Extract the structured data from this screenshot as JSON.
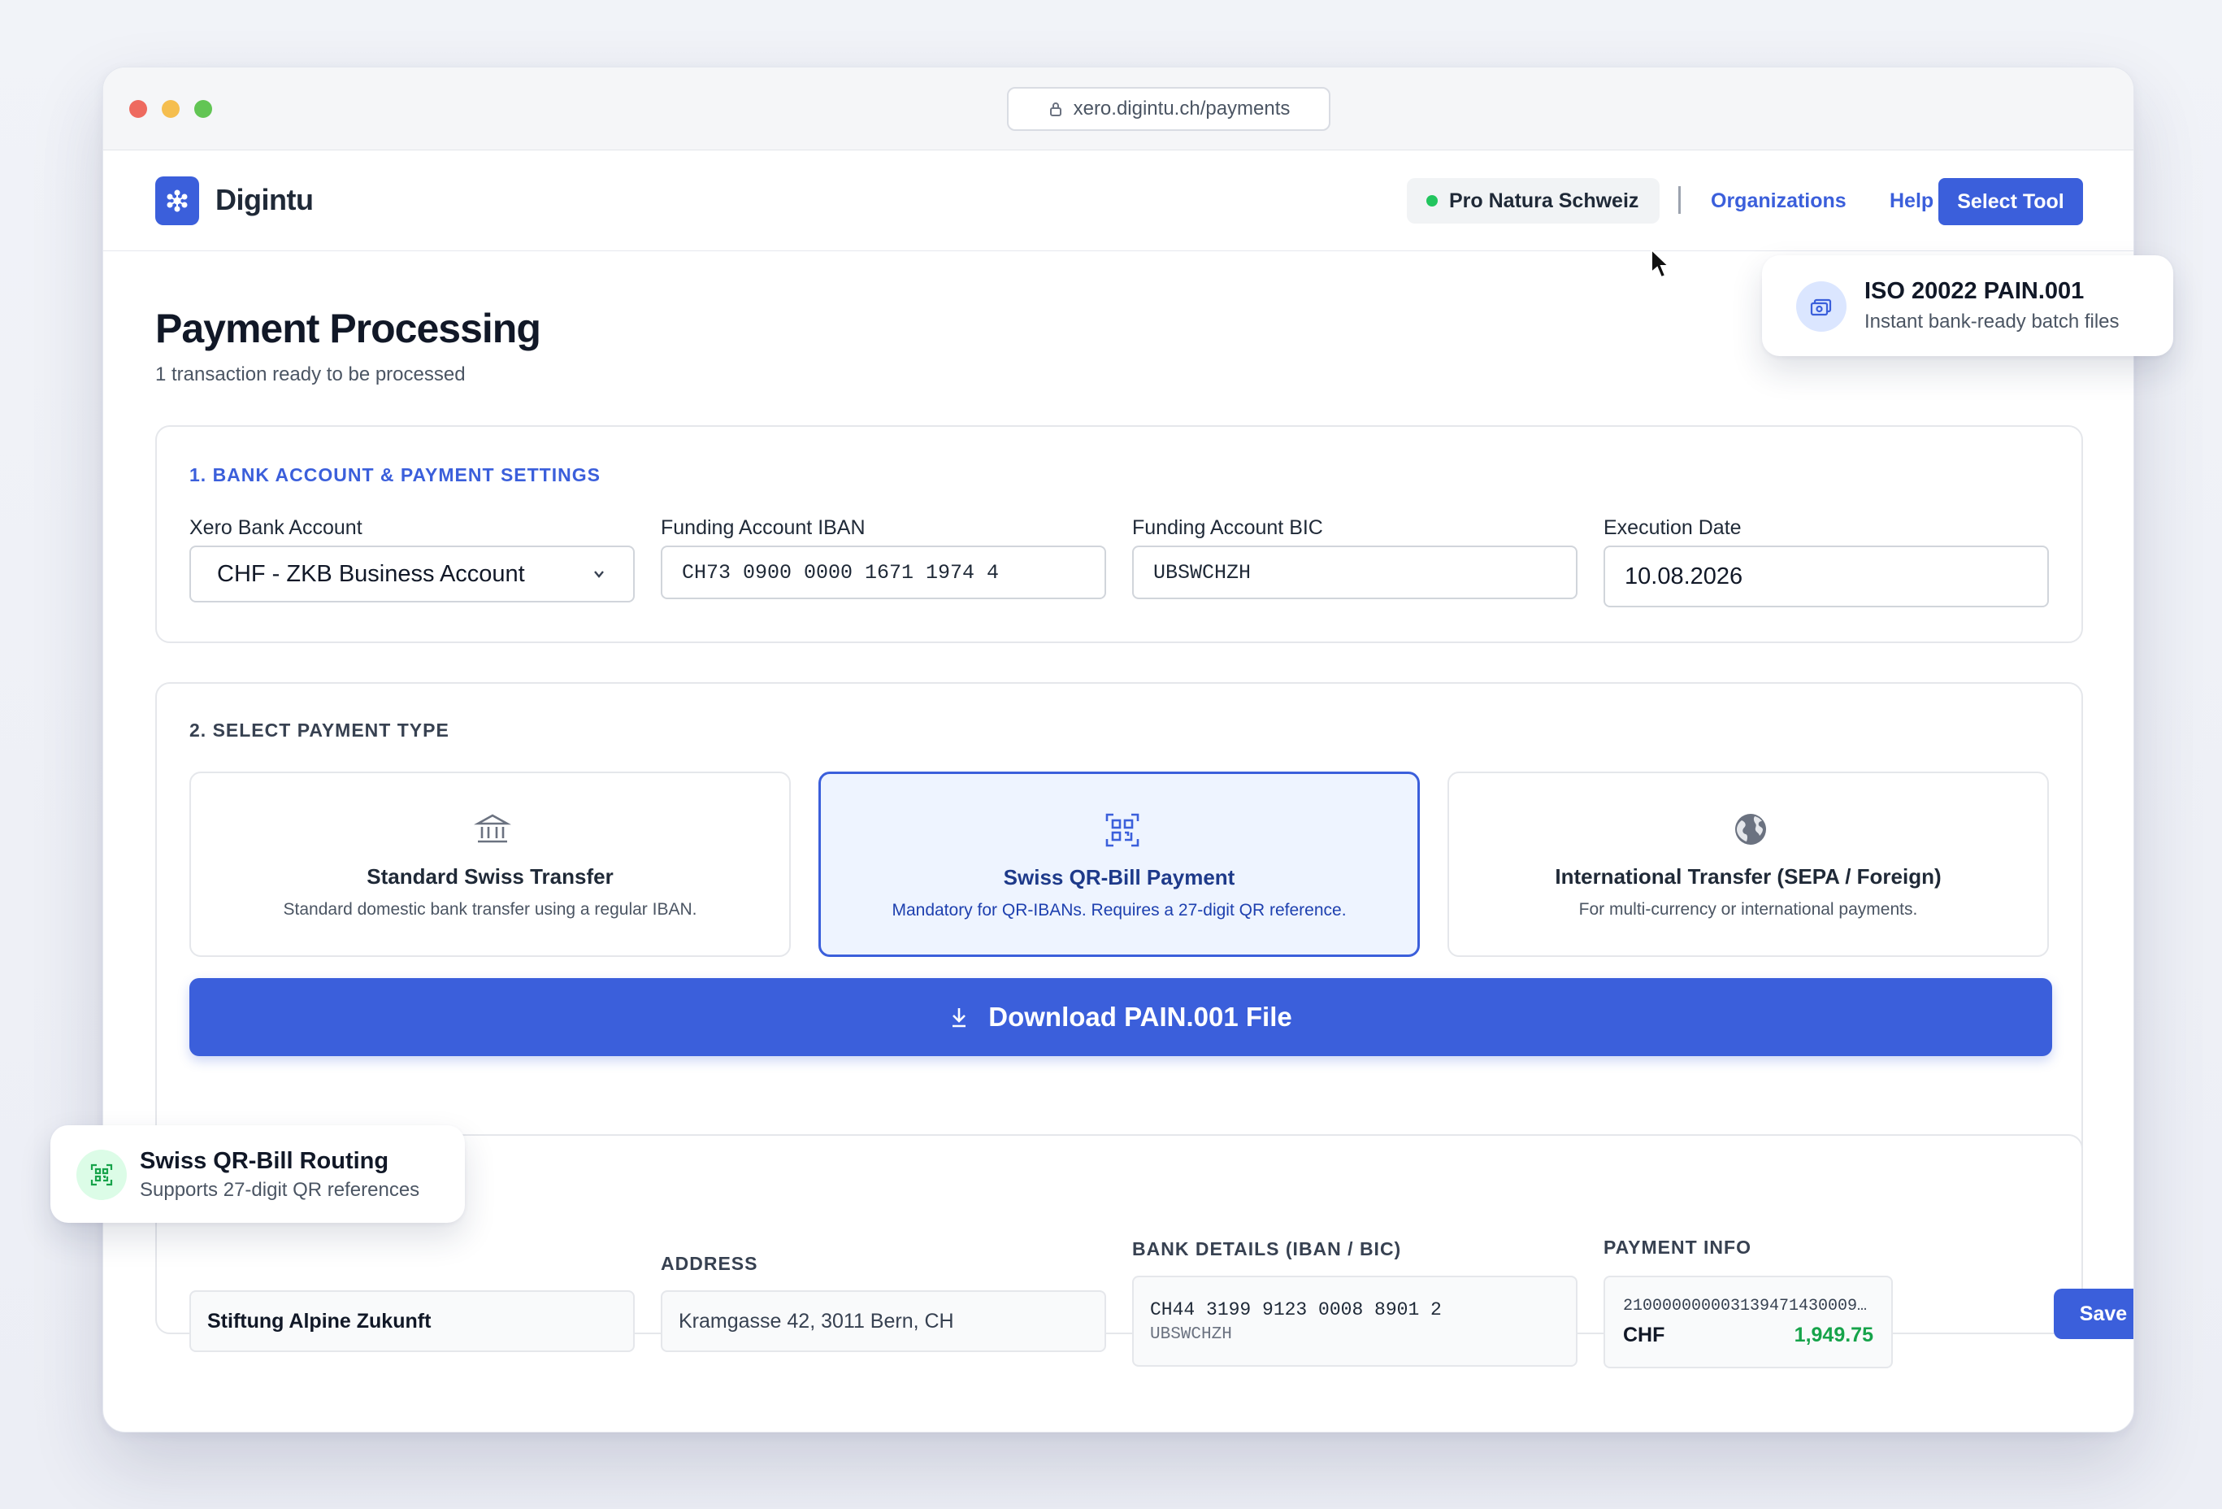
{
  "browser": {
    "url": "xero.digintu.ch/payments"
  },
  "header": {
    "brand": "Digintu",
    "organization": "Pro Natura Schweiz",
    "nav": {
      "organizations": "Organizations",
      "help": "Help"
    },
    "select_tool": "Select Tool"
  },
  "page": {
    "title": "Payment Processing",
    "subtitle": "1 transaction ready to be processed"
  },
  "settings": {
    "section_title": "1. BANK ACCOUNT & PAYMENT SETTINGS",
    "xero_bank_account": {
      "label": "Xero Bank Account",
      "value": "CHF - ZKB Business Account"
    },
    "funding_iban": {
      "label": "Funding Account IBAN",
      "value": "CH73 0900 0000 1671 1974 4"
    },
    "funding_bic": {
      "label": "Funding Account BIC",
      "value": "UBSWCHZH"
    },
    "execution_date": {
      "label": "Execution Date",
      "value": "10.08.2026"
    }
  },
  "payment_type": {
    "section_title": "2. SELECT PAYMENT TYPE",
    "options": [
      {
        "title": "Standard Swiss Transfer",
        "desc": "Standard domestic bank transfer using a regular IBAN.",
        "icon": "bank-icon"
      },
      {
        "title": "Swiss QR-Bill Payment",
        "desc": "Mandatory for QR-IBANs. Requires a 27-digit QR reference.",
        "icon": "qr-code-icon",
        "selected": true
      },
      {
        "title": "International Transfer (SEPA / Foreign)",
        "desc": "For multi-currency or international payments.",
        "icon": "globe-icon"
      }
    ],
    "download_label": "Download PAIN.001 File"
  },
  "payment_row": {
    "labels": {
      "address": "ADDRESS",
      "bank_details": "BANK DETAILS (IBAN / BIC)",
      "payment_info": "PAYMENT INFO"
    },
    "recipient": "Stiftung Alpine Zukunft",
    "address": "Kramgasse 42, 3011 Bern, CH",
    "iban": "CH44 3199 9123 0008 8901 2",
    "bic": "UBSWCHZH",
    "reference": "210000000003139471430009…",
    "currency": "CHF",
    "amount": "1,949.75",
    "save_label": "Save"
  },
  "toasts": {
    "iso": {
      "title": "ISO 20022 PAIN.001",
      "desc": "Instant bank-ready batch files"
    },
    "qr": {
      "title": "Swiss QR-Bill Routing",
      "desc": "Supports 27-digit QR references"
    }
  },
  "colors": {
    "accent": "#3b5fdb",
    "success": "#16a34a",
    "status_dot": "#22c55e"
  }
}
